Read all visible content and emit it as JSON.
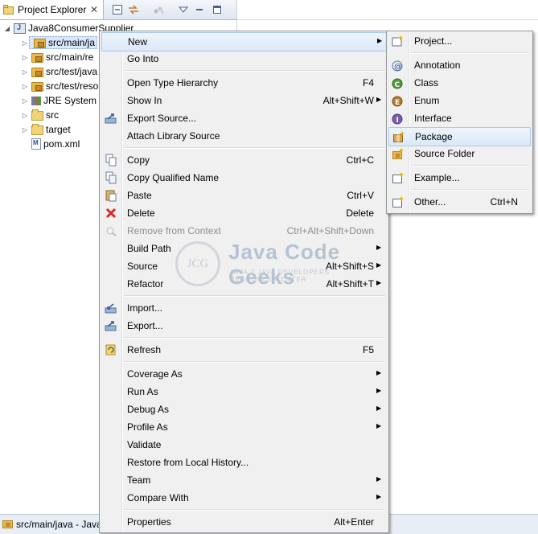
{
  "explorer": {
    "tab_title": "Project Explorer",
    "tab_close": "✕",
    "project": "Java8ConsumerSupplier",
    "items": [
      {
        "label": "src/main/java",
        "display": "src/main/ja"
      },
      {
        "label": "src/main/resources",
        "display": "src/main/re"
      },
      {
        "label": "src/test/java",
        "display": "src/test/java"
      },
      {
        "label": "src/test/resources",
        "display": "src/test/reso"
      },
      {
        "label": "JRE System Library",
        "display": "JRE System"
      },
      {
        "label": "src",
        "display": "src"
      },
      {
        "label": "target",
        "display": "target"
      },
      {
        "label": "pom.xml",
        "display": "pom.xml"
      }
    ]
  },
  "status_bar": {
    "text": "src/main/java - Java"
  },
  "context_menu": {
    "items": [
      {
        "label": "New",
        "submenu": true,
        "highlighted": true
      },
      {
        "label": "Go Into"
      },
      {
        "label": "Open Type Hierarchy",
        "accelerator": "F4"
      },
      {
        "label": "Show In",
        "accelerator": "Alt+Shift+W",
        "submenu": true
      },
      {
        "label": "Export Source..."
      },
      {
        "label": "Attach Library Source"
      },
      {
        "label": "Copy",
        "accelerator": "Ctrl+C"
      },
      {
        "label": "Copy Qualified Name"
      },
      {
        "label": "Paste",
        "accelerator": "Ctrl+V"
      },
      {
        "label": "Delete",
        "accelerator": "Delete"
      },
      {
        "label": "Remove from Context",
        "accelerator": "Ctrl+Alt+Shift+Down",
        "disabled": true
      },
      {
        "label": "Build Path",
        "submenu": true
      },
      {
        "label": "Source",
        "accelerator": "Alt+Shift+S",
        "submenu": true
      },
      {
        "label": "Refactor",
        "accelerator": "Alt+Shift+T",
        "submenu": true
      },
      {
        "label": "Import..."
      },
      {
        "label": "Export..."
      },
      {
        "label": "Refresh",
        "accelerator": "F5"
      },
      {
        "label": "Coverage As",
        "submenu": true
      },
      {
        "label": "Run As",
        "submenu": true
      },
      {
        "label": "Debug As",
        "submenu": true
      },
      {
        "label": "Profile As",
        "submenu": true
      },
      {
        "label": "Validate"
      },
      {
        "label": "Restore from Local History..."
      },
      {
        "label": "Team",
        "submenu": true
      },
      {
        "label": "Compare With",
        "submenu": true
      },
      {
        "label": "Properties",
        "accelerator": "Alt+Enter"
      }
    ]
  },
  "new_submenu": {
    "items": [
      {
        "label": "Project..."
      },
      {
        "label": "Annotation"
      },
      {
        "label": "Class"
      },
      {
        "label": "Enum"
      },
      {
        "label": "Interface"
      },
      {
        "label": "Package",
        "highlighted": true
      },
      {
        "label": "Source Folder"
      },
      {
        "label": "Example..."
      },
      {
        "label": "Other...",
        "accelerator": "Ctrl+N"
      }
    ]
  },
  "watermark": {
    "logo": "JCG",
    "title": "Java Code Geeks",
    "tagline": "JAVA 2 JAVA DEVELOPERS RESOURCE CENTER"
  },
  "colors": {
    "menu_bg": "#f0f0f0",
    "highlight_bg": "#dbe8f8",
    "highlight_border": "#a8c8ec",
    "disabled_text": "#8d8d8d"
  }
}
